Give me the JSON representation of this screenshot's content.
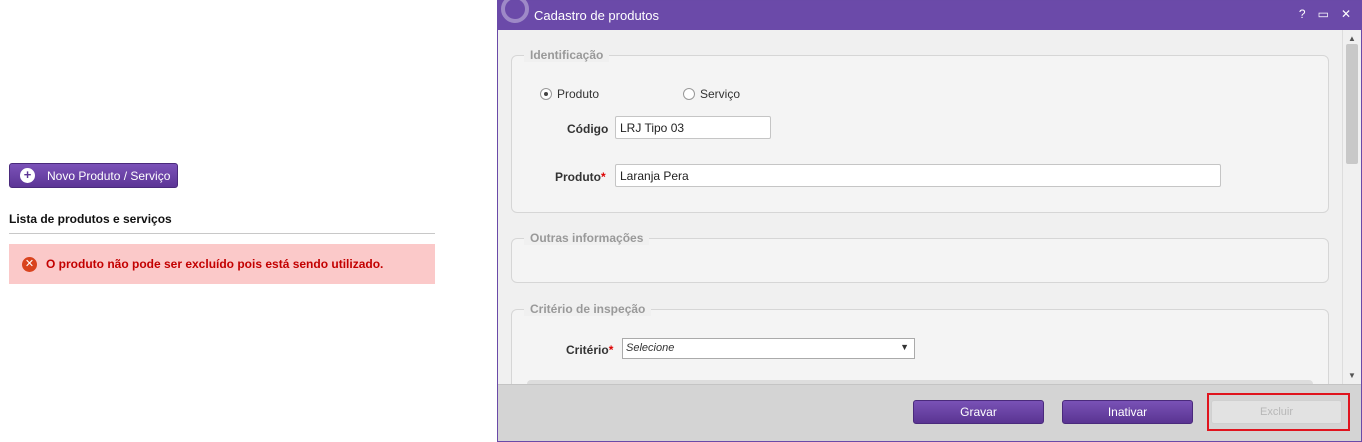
{
  "left_panel": {
    "new_button_label": "Novo Produto / Serviço",
    "list_title": "Lista de produtos e serviços",
    "error_message": "O produto não pode ser excluído pois está sendo utilizado."
  },
  "modal": {
    "title": "Cadastro de produtos",
    "title_icons": [
      "?",
      "▭",
      "✕"
    ],
    "group_identificacao": {
      "legend": "Identificação",
      "radio_produto": "Produto",
      "radio_servico": "Serviço",
      "selected": "Produto",
      "codigo_label": "Código",
      "codigo_value": "LRJ Tipo 03",
      "produto_label": "Produto",
      "produto_required": "*",
      "produto_value": "Laranja Pera"
    },
    "group_outras": {
      "legend": "Outras informações"
    },
    "group_criterio": {
      "legend": "Critério de inspeção",
      "criterio_label": "Critério",
      "criterio_required": "*",
      "criterio_value": "Selecione"
    },
    "footer": {
      "gravar_label": "Gravar",
      "inativar_label": "Inativar",
      "excluir_label": "Excluir"
    }
  },
  "colors": {
    "accent": "#6b4aa9",
    "error_bg": "#fbc9c9",
    "error_text": "#c30000",
    "highlight": "#e0141e"
  }
}
